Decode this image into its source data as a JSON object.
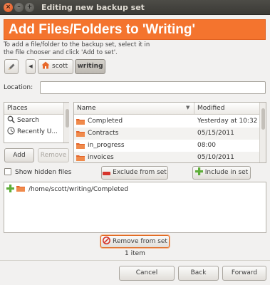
{
  "window": {
    "title": "Editing new backup set"
  },
  "header": {
    "title": "Add Files/Folders to 'Writing'"
  },
  "instructions": {
    "line1": "To add a file/folder to the backup set, select it in",
    "line2": "the file chooser and click 'Add to set'."
  },
  "pathbar": {
    "crumbs": [
      "scott",
      "writing"
    ]
  },
  "location": {
    "label": "Location:",
    "value": ""
  },
  "places": {
    "header": "Places",
    "items": [
      {
        "label": "Search",
        "icon": "search-icon"
      },
      {
        "label": "Recently U...",
        "icon": "recent-icon"
      }
    ],
    "add_label": "Add",
    "remove_label": "Remove"
  },
  "files": {
    "columns": {
      "name": "Name",
      "modified": "Modified"
    },
    "rows": [
      {
        "name": "Completed",
        "modified": "Yesterday at 10:32"
      },
      {
        "name": "Contracts",
        "modified": "05/15/2011"
      },
      {
        "name": "in_progress",
        "modified": "08:00"
      },
      {
        "name": "invoices",
        "modified": "05/10/2011"
      }
    ]
  },
  "options": {
    "show_hidden": "Show hidden files",
    "exclude_label": "Exclude from set",
    "include_label": "Include in set"
  },
  "backup_set": {
    "items": [
      "/home/scott/writing/Completed"
    ],
    "remove_label": "Remove from set",
    "count": "1 item"
  },
  "footer": {
    "cancel": "Cancel",
    "back": "Back",
    "forward": "Forward"
  },
  "colors": {
    "accent": "#f4742e",
    "folder": "#e2632a",
    "plus": "#5fae3a"
  }
}
